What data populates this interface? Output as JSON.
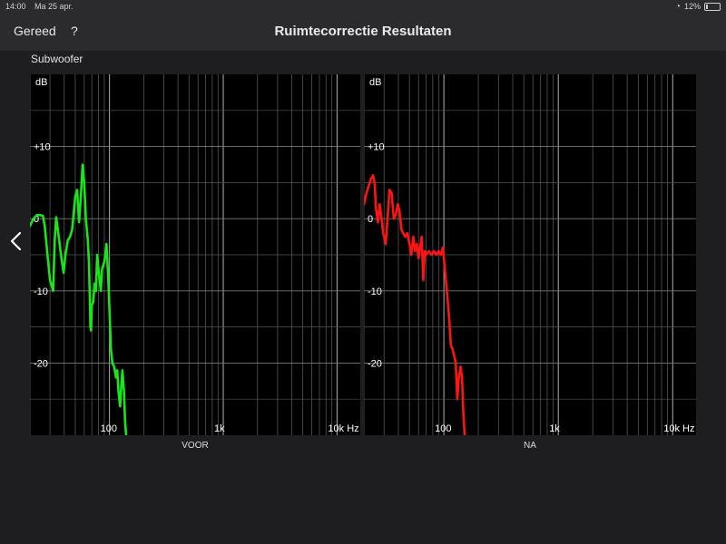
{
  "status": {
    "time": "14:00",
    "date": "Ma 25 apr.",
    "battery": "12%",
    "icons": [
      "wifi-icon",
      "battery-icon"
    ]
  },
  "nav": {
    "done_label": "Gereed",
    "help_label": "?",
    "title": "Ruimtecorrectie Resultaten"
  },
  "section": {
    "title": "Subwoofer",
    "back_icon": "chevron-left-icon"
  },
  "colors": {
    "before": "#19e619",
    "after": "#ff1414",
    "grid": "#555555",
    "grid_major": "#b0b0b0"
  },
  "chart_data": [
    {
      "type": "line",
      "scale_x": "log",
      "grid": true,
      "xlim": [
        20,
        16000
      ],
      "ylim": [
        -30,
        20
      ],
      "xticks": [
        {
          "value": 100,
          "label": "100"
        },
        {
          "value": 1000,
          "label": "1k"
        },
        {
          "value": 10000,
          "label": "10k Hz"
        }
      ],
      "yticks": [
        {
          "value": 10,
          "label": "+10"
        },
        {
          "value": 0,
          "label": "0"
        },
        {
          "value": -10,
          "label": "-10"
        },
        {
          "value": -20,
          "label": "-20"
        }
      ],
      "ylabel": "dB",
      "xlabel": "VOOR",
      "series": [
        {
          "color": "#19e619",
          "points": [
            [
              20,
              -1
            ],
            [
              21.5,
              0
            ],
            [
              23,
              0.5
            ],
            [
              24.5,
              0.5
            ],
            [
              26,
              0.4
            ],
            [
              27,
              -1
            ],
            [
              28.5,
              -5
            ],
            [
              30,
              -8.5
            ],
            [
              32,
              -10
            ],
            [
              33,
              -3
            ],
            [
              34,
              0.2
            ],
            [
              35.5,
              -2
            ],
            [
              37.5,
              -5
            ],
            [
              39.5,
              -7.5
            ],
            [
              41,
              -5
            ],
            [
              43,
              -3
            ],
            [
              45,
              -2.5
            ],
            [
              47,
              -1.5
            ],
            [
              50,
              3
            ],
            [
              52,
              4
            ],
            [
              54,
              -0.5
            ],
            [
              56,
              3
            ],
            [
              58,
              7.5
            ],
            [
              60,
              5
            ],
            [
              62,
              0
            ],
            [
              64.5,
              -3
            ],
            [
              66,
              -6
            ],
            [
              67,
              -10
            ],
            [
              68,
              -15
            ],
            [
              69,
              -15.5
            ],
            [
              70,
              -12
            ],
            [
              72,
              -11.5
            ],
            [
              74,
              -9
            ],
            [
              76,
              -10
            ],
            [
              78,
              -5
            ],
            [
              80,
              -7
            ],
            [
              82,
              -8.5
            ],
            [
              84,
              -10
            ],
            [
              86,
              -7
            ],
            [
              88,
              -6.5
            ],
            [
              90,
              -6
            ],
            [
              92,
              -5
            ],
            [
              94,
              -3.5
            ],
            [
              96,
              -6
            ],
            [
              98,
              -9
            ],
            [
              100,
              -12.5
            ],
            [
              103,
              -18
            ],
            [
              106,
              -20
            ],
            [
              110,
              -20.5
            ],
            [
              114,
              -22
            ],
            [
              117,
              -21
            ],
            [
              120,
              -24
            ],
            [
              124,
              -26
            ],
            [
              127,
              -23
            ],
            [
              130,
              -21
            ],
            [
              134,
              -24
            ],
            [
              137,
              -28
            ],
            [
              140,
              -30
            ]
          ]
        }
      ]
    },
    {
      "type": "line",
      "scale_x": "log",
      "grid": true,
      "xlim": [
        20,
        16000
      ],
      "ylim": [
        -30,
        20
      ],
      "xticks": [
        {
          "value": 100,
          "label": "100"
        },
        {
          "value": 1000,
          "label": "1k"
        },
        {
          "value": 10000,
          "label": "10k Hz"
        }
      ],
      "yticks": [
        {
          "value": 10,
          "label": "+10"
        },
        {
          "value": 0,
          "label": "0"
        },
        {
          "value": -10,
          "label": "-10"
        },
        {
          "value": -20,
          "label": "-20"
        }
      ],
      "ylabel": "dB",
      "xlabel": "NA",
      "series": [
        {
          "color": "#ff1414",
          "points": [
            [
              20,
              2
            ],
            [
              21,
              3.5
            ],
            [
              22,
              4.5
            ],
            [
              23,
              5.5
            ],
            [
              24,
              6
            ],
            [
              24.8,
              5
            ],
            [
              25.5,
              1.5
            ],
            [
              26.5,
              -0.5
            ],
            [
              27.5,
              2
            ],
            [
              28.5,
              0
            ],
            [
              29.5,
              -2
            ],
            [
              31,
              -3.5
            ],
            [
              32.5,
              1
            ],
            [
              33.5,
              4
            ],
            [
              35,
              3.5
            ],
            [
              36.5,
              0
            ],
            [
              38,
              0.5
            ],
            [
              39.5,
              2
            ],
            [
              41,
              1
            ],
            [
              42.5,
              -1.5
            ],
            [
              44,
              -2
            ],
            [
              46,
              -2.5
            ],
            [
              48,
              -2
            ],
            [
              50,
              -3.5
            ],
            [
              52,
              -5
            ],
            [
              54,
              -2.5
            ],
            [
              56,
              -4.5
            ],
            [
              58,
              -3.5
            ],
            [
              60,
              -5.5
            ],
            [
              62,
              -4
            ],
            [
              64,
              -2.5
            ],
            [
              66,
              -8.5
            ],
            [
              68,
              -4.5
            ],
            [
              70,
              -5
            ],
            [
              74,
              -4.5
            ],
            [
              78,
              -5
            ],
            [
              82,
              -4.5
            ],
            [
              86,
              -5
            ],
            [
              90,
              -4.5
            ],
            [
              94,
              -5
            ],
            [
              98,
              -4
            ],
            [
              102,
              -7
            ],
            [
              107,
              -10.5
            ],
            [
              111,
              -13.5
            ],
            [
              115,
              -17.5
            ],
            [
              119,
              -18
            ],
            [
              123,
              -19
            ],
            [
              127,
              -20
            ],
            [
              131,
              -25
            ],
            [
              135,
              -22
            ],
            [
              140,
              -20.5
            ],
            [
              144,
              -22
            ],
            [
              148,
              -27
            ],
            [
              152,
              -30
            ]
          ]
        }
      ]
    }
  ],
  "labels": {
    "before": "VOOR",
    "after": "NA"
  }
}
